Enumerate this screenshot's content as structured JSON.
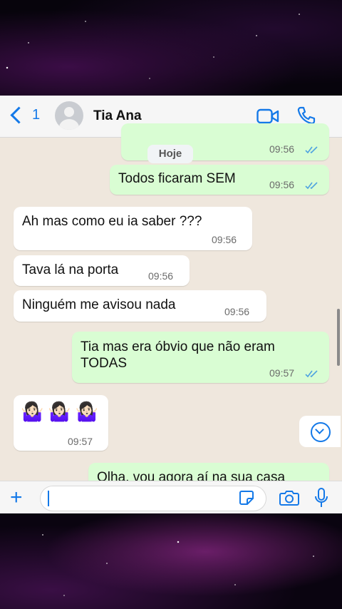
{
  "header": {
    "back_count": "1",
    "contact_name": "Tia Ana"
  },
  "chat": {
    "date_pill": "Hoje",
    "messages": [
      {
        "dir": "out",
        "text": "",
        "time": "09:56"
      },
      {
        "dir": "out",
        "text": "Todos ficaram SEM",
        "time": "09:56"
      },
      {
        "dir": "in",
        "text": "Ah mas como eu ia saber ???",
        "time": "09:56"
      },
      {
        "dir": "in",
        "text": "Tava lá na porta",
        "time": "09:56"
      },
      {
        "dir": "in",
        "text": "Ninguém me avisou nada",
        "time": "09:56"
      },
      {
        "dir": "out",
        "text": "Tia mas era óbvio que não eram TODAS",
        "time": "09:57"
      },
      {
        "dir": "in",
        "text": "🤷🏻‍♀️🤷🏻‍♀️🤷🏻‍♀️",
        "time": "09:57"
      },
      {
        "dir": "out",
        "text": "Olha, vou agora aí na sua casa",
        "time": ""
      }
    ]
  },
  "input": {
    "placeholder": ""
  },
  "colors": {
    "accent": "#1479e8",
    "outgoing_bubble": "#d9fdd3",
    "incoming_bubble": "#ffffff",
    "chat_background": "#efe7dd"
  },
  "icons": [
    "back-chevron-icon",
    "avatar-icon",
    "video-call-icon",
    "phone-call-icon",
    "plus-icon",
    "sticker-icon",
    "camera-icon",
    "microphone-icon",
    "scroll-down-icon",
    "read-ticks-icon"
  ]
}
